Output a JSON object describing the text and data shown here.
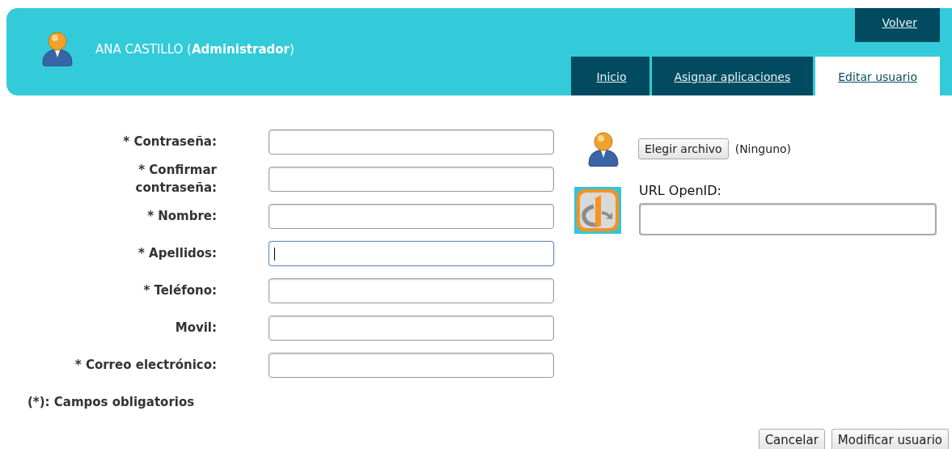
{
  "header": {
    "user_name": "ANA CASTILLO (**Administrador**)",
    "back_link": "Volver"
  },
  "tabs": [
    {
      "label": "Inicio",
      "selected": false
    },
    {
      "label": "Asignar aplicaciones",
      "selected": false
    },
    {
      "label": "Editar usuario",
      "selected": true
    }
  ],
  "form": {
    "fields": [
      {
        "label": "* Contraseña:",
        "focused": false
      },
      {
        "label": "* Confirmar\ncontraseña:",
        "focused": false
      },
      {
        "label": "* Nombre:",
        "focused": false
      },
      {
        "label": "* Apellidos:",
        "focused": true
      },
      {
        "label": "* Teléfono:",
        "focused": false
      },
      {
        "label": "Movil:",
        "focused": false
      },
      {
        "label": "* Correo electrónico:",
        "focused": false
      }
    ],
    "required_note": "(*): Campos obligatorios"
  },
  "photo": {
    "button": "Elegir archivo",
    "file_status": "(Ninguno)"
  },
  "openid": {
    "label": "URL OpenID:"
  },
  "buttons": [
    "Cancelar",
    "Modificar usuario"
  ]
}
